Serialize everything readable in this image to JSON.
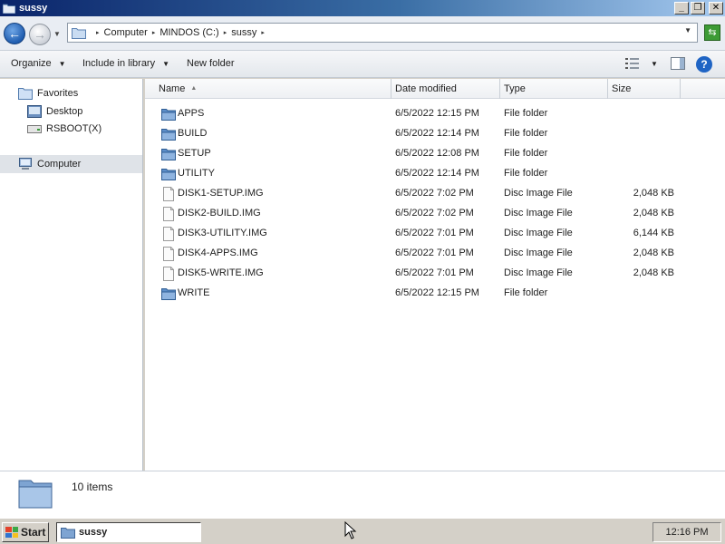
{
  "window": {
    "title": "sussy"
  },
  "address": {
    "crumbs": [
      "Computer",
      "MINDOS (C:)",
      "sussy"
    ]
  },
  "toolbar": {
    "organize": "Organize",
    "include_in_library": "Include in library",
    "new_folder": "New folder"
  },
  "nav": {
    "favorites": "Favorites",
    "desktop": "Desktop",
    "rsboot": "RSBOOT(X)",
    "computer": "Computer"
  },
  "columns": {
    "name": "Name",
    "date": "Date modified",
    "type": "Type",
    "size": "Size"
  },
  "files": [
    {
      "name": "APPS",
      "date": "6/5/2022 12:15 PM",
      "type": "File folder",
      "size": "",
      "kind": "folder"
    },
    {
      "name": "BUILD",
      "date": "6/5/2022 12:14 PM",
      "type": "File folder",
      "size": "",
      "kind": "folder"
    },
    {
      "name": "SETUP",
      "date": "6/5/2022 12:08 PM",
      "type": "File folder",
      "size": "",
      "kind": "folder"
    },
    {
      "name": "UTILITY",
      "date": "6/5/2022 12:14 PM",
      "type": "File folder",
      "size": "",
      "kind": "folder"
    },
    {
      "name": "DISK1-SETUP.IMG",
      "date": "6/5/2022 7:02 PM",
      "type": "Disc Image File",
      "size": "2,048 KB",
      "kind": "file"
    },
    {
      "name": "DISK2-BUILD.IMG",
      "date": "6/5/2022 7:02 PM",
      "type": "Disc Image File",
      "size": "2,048 KB",
      "kind": "file"
    },
    {
      "name": "DISK3-UTILITY.IMG",
      "date": "6/5/2022 7:01 PM",
      "type": "Disc Image File",
      "size": "6,144 KB",
      "kind": "file"
    },
    {
      "name": "DISK4-APPS.IMG",
      "date": "6/5/2022 7:01 PM",
      "type": "Disc Image File",
      "size": "2,048 KB",
      "kind": "file"
    },
    {
      "name": "DISK5-WRITE.IMG",
      "date": "6/5/2022 7:01 PM",
      "type": "Disc Image File",
      "size": "2,048 KB",
      "kind": "file"
    },
    {
      "name": "WRITE",
      "date": "6/5/2022 12:15 PM",
      "type": "File folder",
      "size": "",
      "kind": "folder"
    }
  ],
  "details": {
    "count": "10 items"
  },
  "taskbar": {
    "start": "Start",
    "task": "sussy",
    "clock": "12:16 PM"
  },
  "colors": {
    "title_start": "#0a246a",
    "folder": "#5d8ec9",
    "accent": "#1f5db0"
  }
}
